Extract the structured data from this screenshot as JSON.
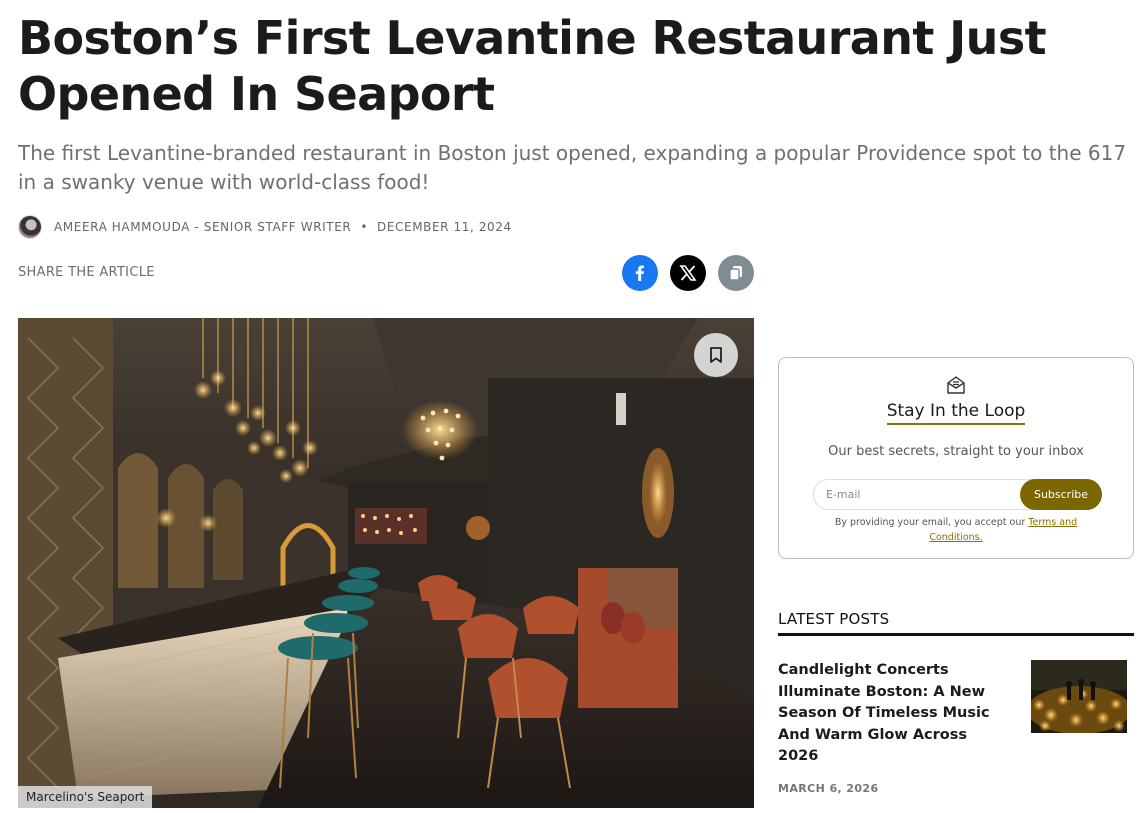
{
  "article": {
    "title": "Boston’s First Levantine Restaurant Just Opened In Seaport",
    "subtitle": "The first Levantine-branded restaurant in Boston just opened, expanding a popular Providence spot to the 617 in a swanky venue with world-class food!",
    "author": "AMEERA HAMMOUDA - SENIOR STAFF WRITER",
    "separator": "•",
    "date": "DECEMBER 11, 2024",
    "share_label": "SHARE THE ARTICLE",
    "image_credit": "Marcelino's Seaport"
  },
  "share": {
    "buttons": [
      {
        "name": "facebook",
        "color": "#1877f2"
      },
      {
        "name": "x",
        "color": "#000000"
      },
      {
        "name": "copy-link",
        "color": "#7f8c92"
      }
    ]
  },
  "newsletter": {
    "title": "Stay In the Loop",
    "description": "Our best secrets, straight to your inbox",
    "email_placeholder": "E-mail",
    "subscribe_label": "Subscribe",
    "legal_prefix": "By providing your email, you accept our ",
    "legal_link": "Terms and Conditions.",
    "accent_color": "#7b6600"
  },
  "latest_posts": {
    "heading": "LATEST POSTS",
    "items": [
      {
        "title": "Candlelight Concerts Illuminate Boston: A New Season Of Timeless Music And Warm Glow Across 2026",
        "date": "MARCH 6, 2026"
      }
    ]
  }
}
